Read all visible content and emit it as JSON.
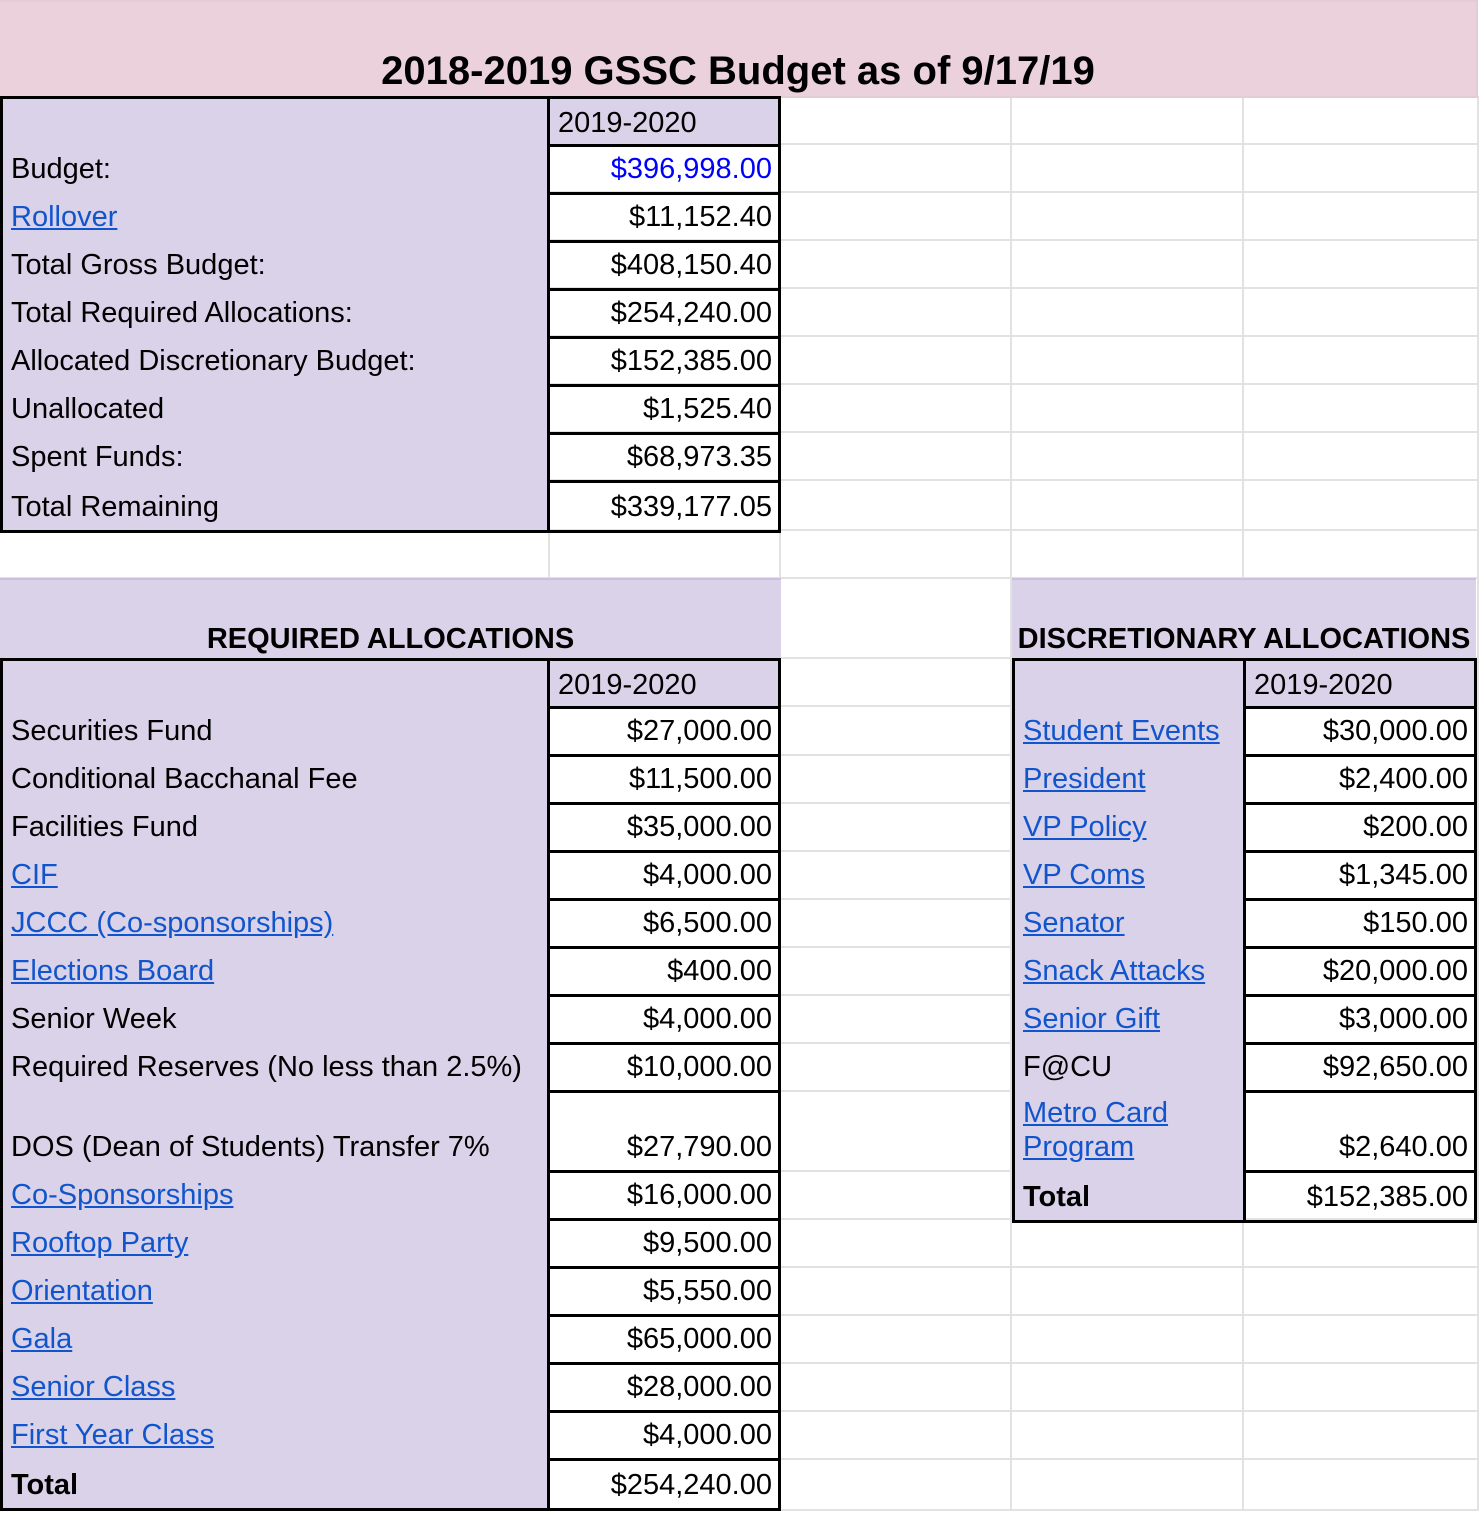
{
  "title": "2018-2019 GSSC Budget as of 9/17/19",
  "summary": {
    "year_header": "2019-2020",
    "rows": [
      {
        "label": "Budget:",
        "value": "$396,998.00"
      },
      {
        "label": "Rollover",
        "value": "$11,152.40"
      },
      {
        "label": "Total Gross Budget:",
        "value": "$408,150.40"
      },
      {
        "label": "Total Required Allocations:",
        "value": "$254,240.00"
      },
      {
        "label": "Allocated Discretionary Budget:",
        "value": "$152,385.00"
      },
      {
        "label": "Unallocated",
        "value": "$1,525.40"
      },
      {
        "label": "Spent Funds:",
        "value": "$68,973.35"
      },
      {
        "label": "Total Remaining",
        "value": "$339,177.05"
      }
    ]
  },
  "required": {
    "title": "REQUIRED ALLOCATIONS",
    "year_header": "2019-2020",
    "rows": [
      {
        "label": "Securities Fund",
        "value": "$27,000.00"
      },
      {
        "label": "Conditional Bacchanal Fee",
        "value": "$11,500.00"
      },
      {
        "label": "Facilities Fund",
        "value": "$35,000.00"
      },
      {
        "label": "CIF",
        "value": "$4,000.00"
      },
      {
        "label": "JCCC (Co-sponsorships)",
        "value": "$6,500.00"
      },
      {
        "label": "Elections Board",
        "value": "$400.00"
      },
      {
        "label": "Senior Week",
        "value": "$4,000.00"
      },
      {
        "label": "Required Reserves (No less than 2.5%)",
        "value": "$10,000.00"
      },
      {
        "label": "DOS (Dean of Students) Transfer 7%",
        "value": "$27,790.00"
      },
      {
        "label": "Co-Sponsorships",
        "value": "$16,000.00"
      },
      {
        "label": "Rooftop Party",
        "value": "$9,500.00"
      },
      {
        "label": "Orientation",
        "value": "$5,550.00"
      },
      {
        "label": "Gala",
        "value": "$65,000.00"
      },
      {
        "label": "Senior Class",
        "value": "$28,000.00"
      },
      {
        "label": "First Year Class",
        "value": "$4,000.00"
      },
      {
        "label": "Total",
        "value": "$254,240.00"
      }
    ]
  },
  "discretionary": {
    "title": "DISCRETIONARY ALLOCATIONS",
    "year_header": "2019-2020",
    "rows": [
      {
        "label": "Student Events",
        "value": "$30,000.00"
      },
      {
        "label": "President",
        "value": "$2,400.00"
      },
      {
        "label": "VP Policy",
        "value": "$200.00"
      },
      {
        "label": "VP Coms",
        "value": "$1,345.00"
      },
      {
        "label": "Senator",
        "value": "$150.00"
      },
      {
        "label": "Snack Attacks",
        "value": "$20,000.00"
      },
      {
        "label": "Senior Gift",
        "value": "$3,000.00"
      },
      {
        "label": "F@CU",
        "value": "$92,650.00"
      },
      {
        "label": "Metro Card Program",
        "value": "$2,640.00"
      },
      {
        "label": "Total",
        "value": "$152,385.00"
      }
    ]
  },
  "colors": {
    "lavender": "#d9d2e9",
    "pink": "#ead1dc",
    "link": "#1155cc",
    "budget_value": "#0000ff"
  }
}
